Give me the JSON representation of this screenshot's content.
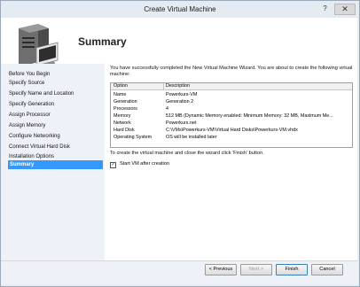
{
  "window": {
    "title": "Create Virtual Machine",
    "help_glyph": "?",
    "close_glyph": "✕"
  },
  "header": {
    "title": "Summary"
  },
  "sidebar": {
    "items": [
      {
        "label": "Before You Begin"
      },
      {
        "label": "Specify Source"
      },
      {
        "label": "Specify Name and Location"
      },
      {
        "label": "Specify Generation"
      },
      {
        "label": "Assign Processor"
      },
      {
        "label": "Assign Memory"
      },
      {
        "label": "Configure Networking"
      },
      {
        "label": "Connect Virtual Hard Disk"
      },
      {
        "label": "Installation Options"
      },
      {
        "label": "Summary"
      }
    ]
  },
  "content": {
    "intro": "You have successfully completed the New Virtual Machine Wizard. You are about to create the following virtual machine:",
    "table": {
      "headers": [
        "Option",
        "Description"
      ],
      "rows": [
        {
          "option": "Name",
          "description": "Powerkurs-VM"
        },
        {
          "option": "Generation",
          "description": "Generation 2"
        },
        {
          "option": "Processors",
          "description": "4"
        },
        {
          "option": "Memory",
          "description": "512 MB (Dynamic Memory enabled: Minimum Memory: 32 MB, Maximum Me..."
        },
        {
          "option": "Network",
          "description": "Powerkurs.net"
        },
        {
          "option": "Hard Disk",
          "description": "C:\\VMs\\Powerkurs-VM\\Virtual Hard Disks\\Powerkurs-VM.vhdx"
        },
        {
          "option": "Operating System",
          "description": "OS will be installed later"
        }
      ]
    },
    "finish_note": "To create the virtual machine and close the wizard click 'Finish' button.",
    "start_vm_label": "Start VM after creation",
    "start_vm_checked": true
  },
  "buttons": {
    "previous": "< Previous",
    "next": "Next >",
    "finish": "Finish",
    "cancel": "Cancel"
  }
}
